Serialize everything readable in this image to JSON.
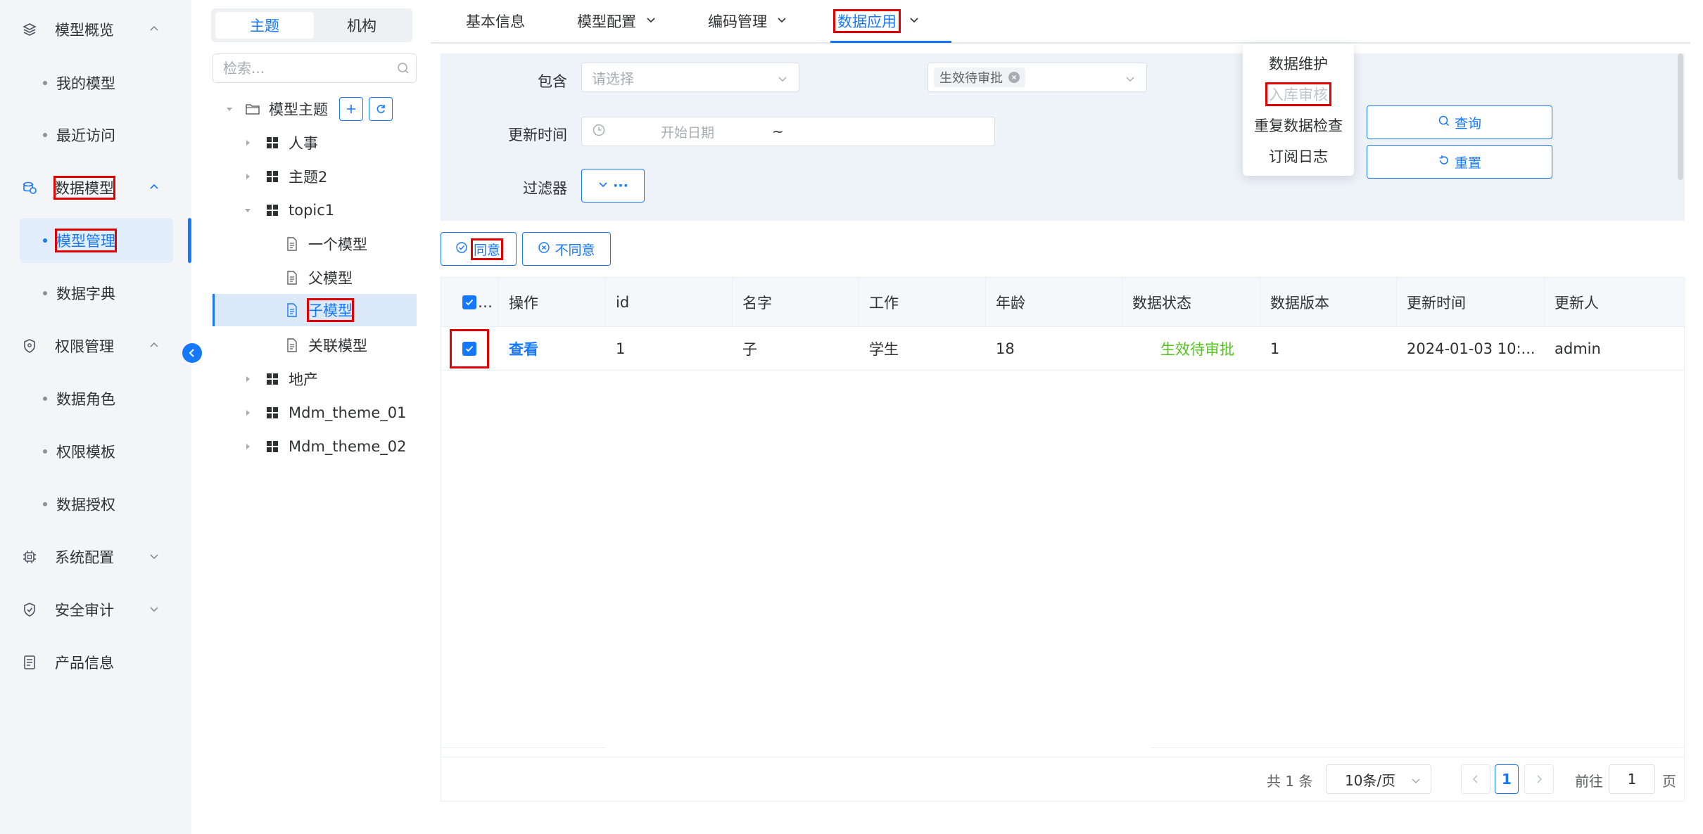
{
  "sidebar": {
    "items": [
      {
        "label": "模型概览",
        "icon": "layers-icon",
        "expanded": true
      },
      {
        "label": "我的模型"
      },
      {
        "label": "最近访问"
      },
      {
        "label": "数据模型",
        "icon": "database-icon",
        "expanded": true
      },
      {
        "label": "模型管理",
        "active": true
      },
      {
        "label": "数据字典"
      },
      {
        "label": "权限管理",
        "icon": "shield-icon",
        "expanded": true
      },
      {
        "label": "数据角色"
      },
      {
        "label": "权限模板"
      },
      {
        "label": "数据授权"
      },
      {
        "label": "系统配置",
        "icon": "chip-icon",
        "expanded": false
      },
      {
        "label": "安全审计",
        "icon": "shield-check-icon",
        "expanded": false
      },
      {
        "label": "产品信息",
        "icon": "document-icon"
      }
    ]
  },
  "tree": {
    "segments": [
      "主题",
      "机构"
    ],
    "search_placeholder": "检索...",
    "root": "模型主题",
    "nodes": [
      {
        "label": "人事"
      },
      {
        "label": "主题2"
      },
      {
        "label": "topic1"
      },
      {
        "label": "一个模型"
      },
      {
        "label": "父模型"
      },
      {
        "label": "子模型",
        "selected": true
      },
      {
        "label": "关联模型"
      },
      {
        "label": "地产"
      },
      {
        "label": "Mdm_theme_01"
      },
      {
        "label": "Mdm_theme_02"
      }
    ]
  },
  "tabs": [
    {
      "label": "基本信息"
    },
    {
      "label": "模型配置"
    },
    {
      "label": "编码管理"
    },
    {
      "label": "数据应用",
      "active": true
    }
  ],
  "dropdown": {
    "items": [
      {
        "label": "数据维护"
      },
      {
        "label": "入库审核",
        "disabled": true
      },
      {
        "label": "重复数据检查"
      },
      {
        "label": "订阅日志"
      }
    ]
  },
  "filter": {
    "contains_label": "包含",
    "contains_placeholder": "请选择",
    "status_tag": "生效待审批",
    "update_time_label": "更新时间",
    "start_date_placeholder": "开始日期",
    "range_sep": "~",
    "filter_label": "过滤器",
    "filter_btn": "···",
    "query_btn": "查询",
    "reset_btn": "重置"
  },
  "actions": {
    "agree": "同意",
    "disagree": "不同意"
  },
  "table": {
    "columns": [
      "…",
      "操作",
      "id",
      "名字",
      "工作",
      "年龄",
      "数据状态",
      "数据版本",
      "更新时间",
      "更新人"
    ],
    "rows": [
      {
        "action": "查看",
        "id": "1",
        "name": "子",
        "job": "学生",
        "age": "18",
        "status": "生效待审批",
        "version": "1",
        "updated": "2024-01-03 10:...",
        "updater": "admin"
      }
    ]
  },
  "pager": {
    "total": "共 1 条",
    "page_size": "10条/页",
    "current": "1",
    "goto_label": "前往",
    "goto_value": "1",
    "page_suffix": "页"
  },
  "colors": {
    "accent": "#1677ff",
    "highlight": "#e00000",
    "success": "#52c41a"
  }
}
